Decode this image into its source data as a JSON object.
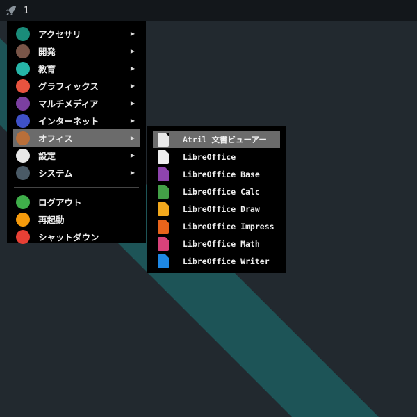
{
  "topbar": {
    "workspace": "1"
  },
  "menu": {
    "items": [
      {
        "label": "アクセサリ",
        "icon": "accessories-icon",
        "color": "#1a8c7a",
        "submenu": true
      },
      {
        "label": "開発",
        "icon": "hammer-icon",
        "color": "#795548",
        "submenu": true
      },
      {
        "label": "教育",
        "icon": "education-icon",
        "color": "#26b5a8",
        "submenu": true
      },
      {
        "label": "グラフィックス",
        "icon": "graphics-icon",
        "color": "#e8533f",
        "submenu": true
      },
      {
        "label": "マルチメディア",
        "icon": "multimedia-icon",
        "color": "#7b3fa0",
        "submenu": true
      },
      {
        "label": "インターネット",
        "icon": "internet-icon",
        "color": "#3f51c8",
        "submenu": true
      },
      {
        "label": "オフィス",
        "icon": "briefcase-icon",
        "color": "#b96f3a",
        "submenu": true,
        "selected": true
      },
      {
        "label": "設定",
        "icon": "settings-icon",
        "color": "#e8e8e8",
        "submenu": true
      },
      {
        "label": "システム",
        "icon": "gear-icon",
        "color": "#4a5a66",
        "submenu": true
      }
    ],
    "actions": [
      {
        "label": "ログアウト",
        "icon": "logout-icon",
        "color": "#3fae4a"
      },
      {
        "label": "再起動",
        "icon": "restart-icon",
        "color": "#f59a0c"
      },
      {
        "label": "シャットダウン",
        "icon": "power-icon",
        "color": "#e84035"
      }
    ]
  },
  "submenu": {
    "items": [
      {
        "label": "Atril 文書ビューアー",
        "icon": "atril-icon",
        "color": "#e8e8e8",
        "selected": true
      },
      {
        "label": "LibreOffice",
        "icon": "libreoffice-icon",
        "color": "#eeeeee"
      },
      {
        "label": "LibreOffice Base",
        "icon": "libreoffice-base-icon",
        "color": "#8e44ad"
      },
      {
        "label": "LibreOffice Calc",
        "icon": "libreoffice-calc-icon",
        "color": "#43a047"
      },
      {
        "label": "LibreOffice Draw",
        "icon": "libreoffice-draw-icon",
        "color": "#f2a81d"
      },
      {
        "label": "LibreOffice Impress",
        "icon": "libreoffice-impress-icon",
        "color": "#e8641b"
      },
      {
        "label": "LibreOffice Math",
        "icon": "libreoffice-math-icon",
        "color": "#d8427a"
      },
      {
        "label": "LibreOffice Writer",
        "icon": "libreoffice-writer-icon",
        "color": "#1e88e5"
      }
    ]
  }
}
